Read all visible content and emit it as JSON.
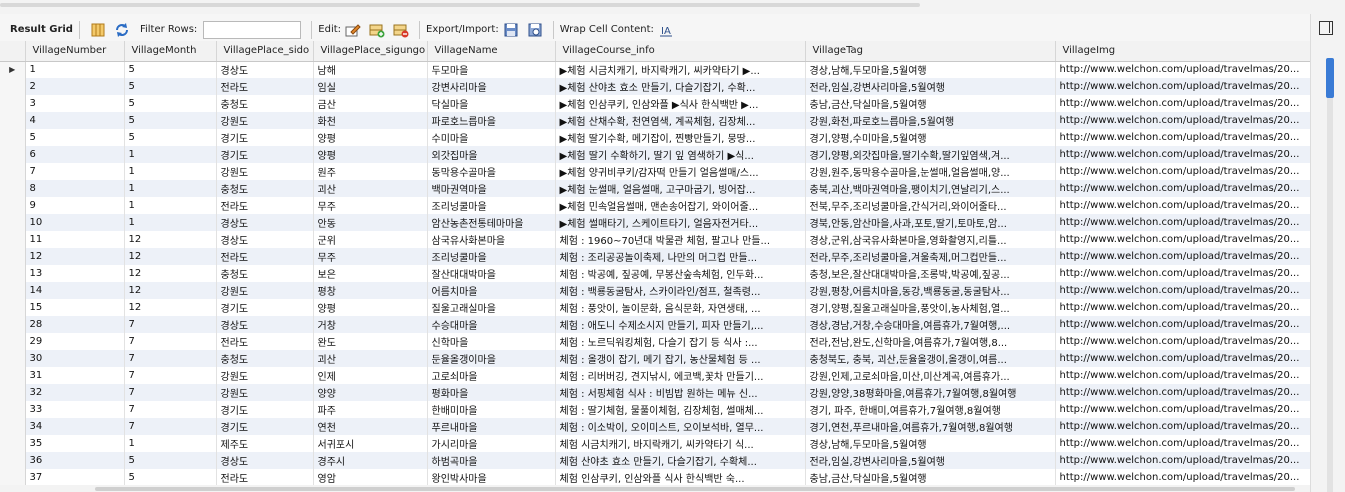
{
  "toolbar": {
    "result_grid": "Result Grid",
    "filter_rows": "Filter Rows:",
    "edit": "Edit:",
    "export_import": "Export/Import:",
    "wrap_cell": "Wrap Cell Content:"
  },
  "columns": [
    "VillageNumber",
    "VillageMonth",
    "VillagePlace_sido",
    "VillagePlace_sigungo",
    "VillageName",
    "VillageCourse_info",
    "VillageTag",
    "VillageImg"
  ],
  "rows": [
    [
      "1",
      "5",
      "경상도",
      "남해",
      "두모마을",
      "▶체험  시금치캐기, 바지락캐기, 씨카약타기 ▶...",
      "경상,남해,두모마을,5월여행",
      "http://www.welchon.com/upload/travelmas/20..."
    ],
    [
      "2",
      "5",
      "전라도",
      "임실",
      "강변사리마을",
      "▶체험 산야초 효소 만들기, 다슬기잡기, 수확...",
      "전라,임실,강변사리마을,5월여행",
      "http://www.welchon.com/upload/travelmas/20..."
    ],
    [
      "3",
      "5",
      "충청도",
      "금산",
      "닥실마을",
      "▶체험 인삼쿠키, 인삼와플 ▶식사  한식백반 ▶...",
      "충남,금산,닥실마을,5월여행",
      "http://www.welchon.com/upload/travelmas/20..."
    ],
    [
      "4",
      "5",
      "강원도",
      "화천",
      "파로호느릅마을",
      "▶체험 산채수확, 천연염색, 계곡체험, 김장체...",
      "강원,화천,파로호느릅마을,5월여행",
      "http://www.welchon.com/upload/travelmas/20..."
    ],
    [
      "5",
      "5",
      "경기도",
      "양평",
      "수미마을",
      "▶체험 딸기수확, 메기잡이, 찐빵만들기, 뭉땅...",
      "경기,양평,수미마을,5월여행",
      "http://www.welchon.com/upload/travelmas/20..."
    ],
    [
      "6",
      "1",
      "경기도",
      "양평",
      "외갓집마을",
      "▶체험  딸기 수확하기, 딸기 잎 염색하기  ▶식...",
      "경기,양평,외갓집마을,딸기수확,딸기잎염색,겨...",
      "http://www.welchon.com/upload/travelmas/20..."
    ],
    [
      "7",
      "1",
      "강원도",
      "원주",
      "동막용수골마을",
      "▶체험  양귀비쿠키/감자떡 만들기  얼음썰매/스...",
      "강원,원주,동막용수골마을,눈썰매,얼음썰매,양...",
      "http://www.welchon.com/upload/travelmas/20..."
    ],
    [
      "8",
      "1",
      "충청도",
      "괴산",
      "백마권역마을",
      "▶체험 눈썰매, 얼음썰매, 고구마굽기, 빙어잡...",
      "충북,괴산,백마권역마을,팽이치기,연날리기,스...",
      "http://www.welchon.com/upload/travelmas/20..."
    ],
    [
      "9",
      "1",
      "전라도",
      "무주",
      "조리넝쿨마을",
      "▶체험 민속얼음썰매, 맨손송어잡기, 와이어줄...",
      "전북,무주,조리넝쿨마을,간식거리,와이어줄타...",
      "http://www.welchon.com/upload/travelmas/20..."
    ],
    [
      "10",
      "1",
      "경상도",
      "안동",
      "암산농촌전통테마마을",
      "▶체험 썰매타기, 스케이트타기, 얼음자전거타...",
      "경북,안동,암산마을,사과,포토,딸기,토마토,암...",
      "http://www.welchon.com/upload/travelmas/20..."
    ],
    [
      "11",
      "12",
      "경상도",
      "군위",
      "삼국유사화본마을",
      "체험 : 1960~70년대 박물관 체험, 팔고나 만들...",
      "경상,군위,삼국유사화본마을,영화촬영지,리틀...",
      "http://www.welchon.com/upload/travelmas/20..."
    ],
    [
      "12",
      "12",
      "전라도",
      "무주",
      "조리넝쿨마을",
      "체험 : 조리공공놀이축제, 나만의 머그컵 만들...",
      "전라,무주,조리넝쿨마을,겨울축제,머그컵만들...",
      "http://www.welchon.com/upload/travelmas/20..."
    ],
    [
      "13",
      "12",
      "충청도",
      "보은",
      "잘산대대박마을",
      "체험 : 박공예, 짚공예, 무봉산숲속체험, 인두화...",
      "충청,보은,잘산대대박마을,조롱박,박공예,짚공...",
      "http://www.welchon.com/upload/travelmas/20..."
    ],
    [
      "14",
      "12",
      "강원도",
      "평창",
      "어름치마을",
      "체험 : 백룡동굴탐사, 스카이라인/점프, 철족령...",
      "강원,평창,어름치마을,동강,백룡동굴,동굴탐사...",
      "http://www.welchon.com/upload/travelmas/20..."
    ],
    [
      "15",
      "12",
      "경기도",
      "양평",
      "질울고래실마을",
      "체험 : 풍앗이, 놀이문화, 음식문화, 자연생태, ...",
      "경기,양평,질울고래실마을,풍앗이,농사체험,열...",
      "http://www.welchon.com/upload/travelmas/20..."
    ],
    [
      "28",
      "7",
      "경상도",
      "거창",
      "수승대마을",
      "체험 : 애도니 수제소시지 만들기, 피자 만들기,...",
      "경상,경남,거창,수승대마을,여름휴가,7월여행,...",
      "http://www.welchon.com/upload/travelmas/20..."
    ],
    [
      "29",
      "7",
      "전라도",
      "완도",
      "신학마을",
      "체험 : 노르딕워킹체험, 다슬기 잡기 등  식사 :...",
      "전라,전남,완도,신학마을,여름휴가,7월여행,8...",
      "http://www.welchon.com/upload/travelmas/20..."
    ],
    [
      "30",
      "7",
      "충청도",
      "괴산",
      "둔율올갱이마을",
      "체험 : 올갱이 잡기, 메기 잡기, 농산물체험 등 ...",
      "충청북도, 충북, 괴산,둔율올갱이,올갱이,여름...",
      "http://www.welchon.com/upload/travelmas/20..."
    ],
    [
      "31",
      "7",
      "강원도",
      "인제",
      "고로쇠마을",
      "체험 : 리버버깅, 견지낚시, 에코백,꽃차 만들기...",
      "강원,인제,고로쇠마을,미산,미산계곡,여름휴가...",
      "http://www.welchon.com/upload/travelmas/20..."
    ],
    [
      "32",
      "7",
      "강원도",
      "양양",
      "평화마을",
      "체험 : 서핑체험  식사 : 비빔밥 원하는 메뉴 신...",
      "강원,양양,38평화마을,여름휴가,7월여행,8월여행",
      "http://www.welchon.com/upload/travelmas/20..."
    ],
    [
      "33",
      "7",
      "경기도",
      "파주",
      "한배미마을",
      "체험 : 딸기체험, 물풀이체험, 김장체험, 썰매체...",
      "경기, 파주, 한배미,여름휴가,7월여행,8월여행",
      "http://www.welchon.com/upload/travelmas/20..."
    ],
    [
      "34",
      "7",
      "경기도",
      "연천",
      "푸르내마을",
      "체험 : 이소박이, 오이미스트, 오이보석바, 열무...",
      "경기,연천,푸르내마을,여름휴가,7월여행,8월여행",
      "http://www.welchon.com/upload/travelmas/20..."
    ],
    [
      "35",
      "1",
      "제주도",
      "서귀포시",
      "가시리마을",
      "체험 시금치캐기, 바지락캐기, 씨카약타기  식...",
      "경상,남해,두모마을,5월여행",
      "http://www.welchon.com/upload/travelmas/20..."
    ],
    [
      "36",
      "5",
      "경상도",
      "경주시",
      "하범곡마을",
      "체험 산야초 효소 만들기, 다슬기잡기, 수확체...",
      "전라,임실,강변사리마을,5월여행",
      "http://www.welchon.com/upload/travelmas/20..."
    ],
    [
      "37",
      "5",
      "전라도",
      "영암",
      "왕인박사마을",
      "체험 인삼쿠키, 인삼와플  식사 한식백반  숙...",
      "충남,금산,닥실마을,5월여행",
      "http://www.welchon.com/upload/travelmas/20..."
    ]
  ]
}
